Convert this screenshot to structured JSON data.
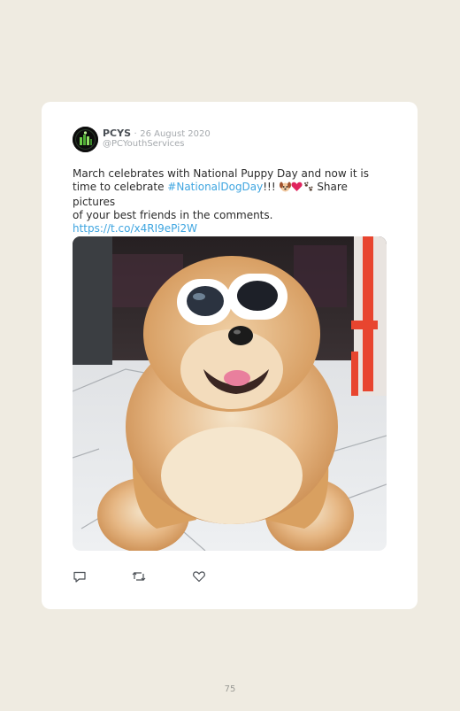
{
  "tweet": {
    "name": "PCYS",
    "separator": "·",
    "date": "26 August 2020",
    "handle": "@PCYouthServices",
    "text_line1": "March celebrates with National Puppy Day and now it is",
    "text_part_before_hashtag": "time to celebrate ",
    "hashtag": "#NationalDogDay",
    "text_after_hashtag": "!!! ",
    "text_after_emoji": " Share pictures",
    "text_line3": "of your best friends in the comments.",
    "link": "https://t.co/x4RI9ePi2W",
    "emojis": [
      "dog-face-icon",
      "red-heart-icon",
      "paw-prints-icon"
    ],
    "image": "chow-chow-dog-with-white-sunglasses"
  },
  "actions": {
    "reply_icon": "reply-icon",
    "retweet_icon": "retweet-icon",
    "like_icon": "heart-icon"
  },
  "page": {
    "number": "75"
  },
  "colors": {
    "background": "#efebe1",
    "card": "#ffffff",
    "link": "#3ea5e0",
    "muted": "#a5a9ad"
  }
}
